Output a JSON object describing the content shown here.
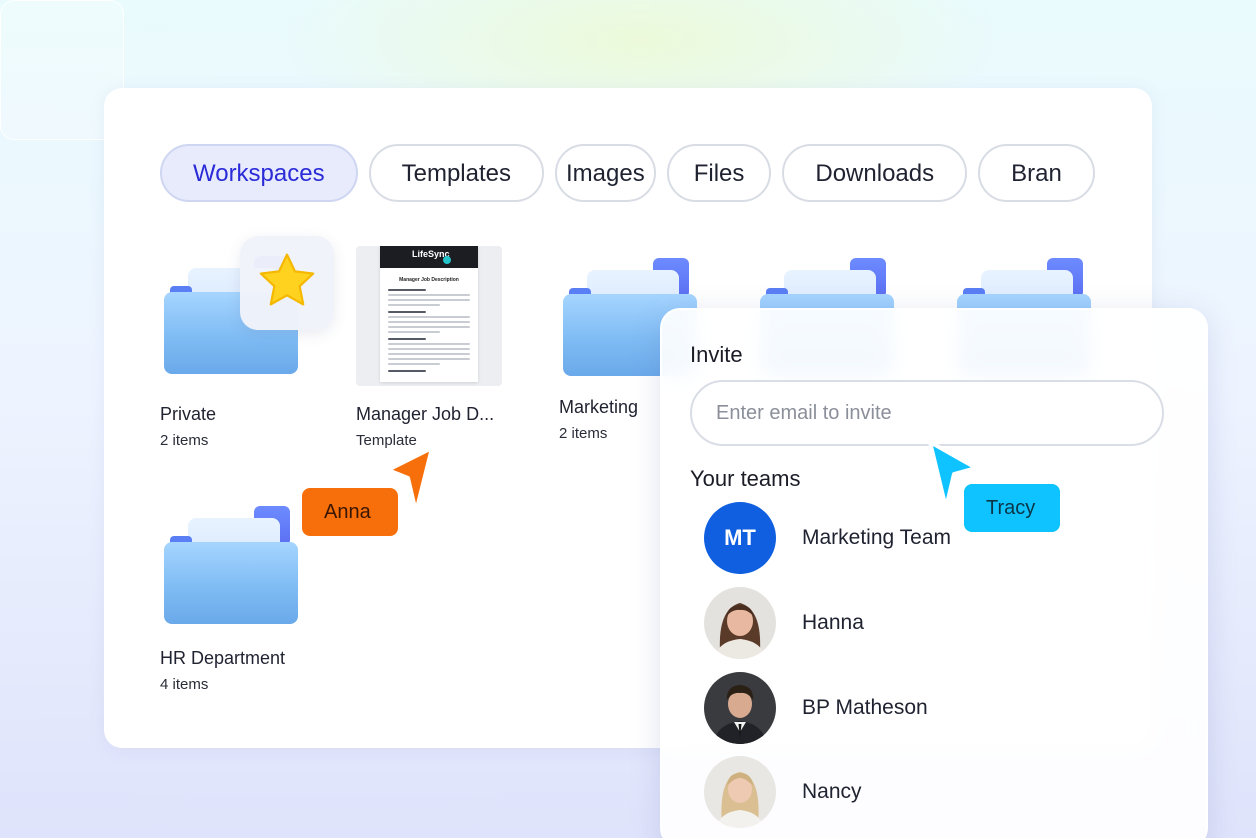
{
  "tabs": [
    {
      "label": "Workspaces",
      "active": true
    },
    {
      "label": "Templates"
    },
    {
      "label": "Images"
    },
    {
      "label": "Files"
    },
    {
      "label": "Downloads"
    },
    {
      "label": "Bran"
    }
  ],
  "items": [
    {
      "name": "Private",
      "sub": "2 items",
      "icon": "folder-icon",
      "badge": "star-icon"
    },
    {
      "name": "Manager Job D...",
      "sub": "Template",
      "icon": "document-thumbnail",
      "thumb": {
        "brand": "LifeSync",
        "title": "Manager Job Description"
      }
    },
    {
      "name": "Marketing",
      "sub": "2 items",
      "icon": "folder-icon"
    },
    {
      "name": "HR Department",
      "sub": "4 items",
      "icon": "folder-icon"
    }
  ],
  "invite": {
    "title": "Invite",
    "email_placeholder": "Enter email to invite",
    "email_value": "",
    "teams_title": "Your teams",
    "members": [
      {
        "name": "Marketing Team",
        "avatar_initials": "MT",
        "avatar_color": "#0f5fe0"
      },
      {
        "name": "Hanna",
        "avatar": "avatar-photo"
      },
      {
        "name": "BP Matheson",
        "avatar": "avatar-photo"
      },
      {
        "name": "Nancy",
        "avatar": "avatar-photo"
      }
    ]
  },
  "collaborators": [
    {
      "name": "Anna",
      "color": "#f76f0a"
    },
    {
      "name": "Tracy",
      "color": "#0ec3ff"
    }
  ],
  "colors": {
    "accent": "#2b2bd8",
    "active_tab_bg": "#e7ebfb",
    "folder_blue": "#7fbcf4"
  }
}
